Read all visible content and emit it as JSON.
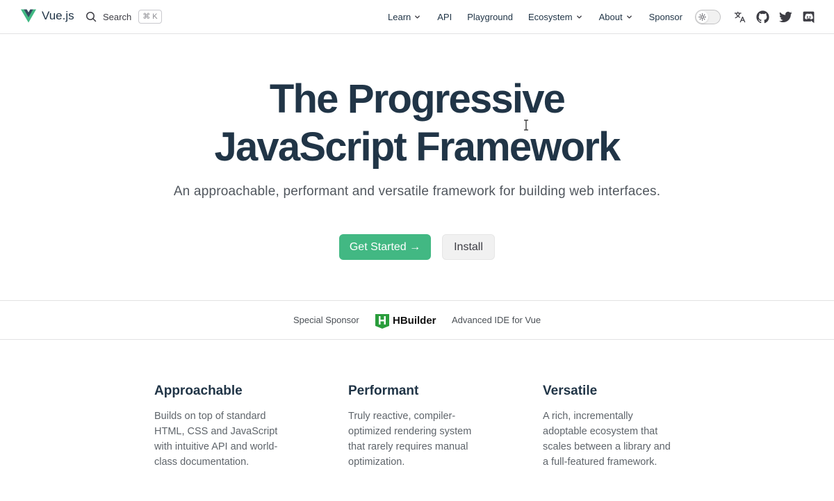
{
  "nav": {
    "logo_text": "Vue.js",
    "search_label": "Search",
    "search_shortcut": "⌘ K",
    "items": [
      {
        "label": "Learn",
        "dropdown": true
      },
      {
        "label": "API",
        "dropdown": false
      },
      {
        "label": "Playground",
        "dropdown": false
      },
      {
        "label": "Ecosystem",
        "dropdown": true
      },
      {
        "label": "About",
        "dropdown": true
      },
      {
        "label": "Sponsor",
        "dropdown": false
      }
    ],
    "icons": [
      "theme-toggle-sun-icon",
      "translate-icon",
      "github-icon",
      "twitter-icon",
      "discord-icon"
    ]
  },
  "hero": {
    "title_line1": "The Progressive",
    "title_line2": "JavaScript Framework",
    "subtitle": "An approachable, performant and versatile framework for building web interfaces.",
    "primary_button": "Get Started →",
    "secondary_button": "Install"
  },
  "sponsor": {
    "label": "Special Sponsor",
    "name": "HBuilder",
    "description": "Advanced IDE for Vue"
  },
  "features": [
    {
      "title": "Approachable",
      "lines": [
        "Builds on top of standard",
        "HTML, CSS and JavaScript",
        "with intuitive API and world-",
        "class documentation."
      ]
    },
    {
      "title": "Performant",
      "lines": [
        "Truly reactive, compiler-",
        "optimized rendering system",
        "that rarely requires manual",
        "optimization."
      ]
    },
    {
      "title": "Versatile",
      "lines": [
        "A rich, incrementally",
        "adoptable ecosystem that",
        "scales between a library and",
        "a full-featured framework."
      ]
    }
  ],
  "colors": {
    "brand_green": "#42b883",
    "brand_dark": "#35495e",
    "text_primary": "#213547",
    "button_secondary_bg": "#f1f1f1"
  }
}
